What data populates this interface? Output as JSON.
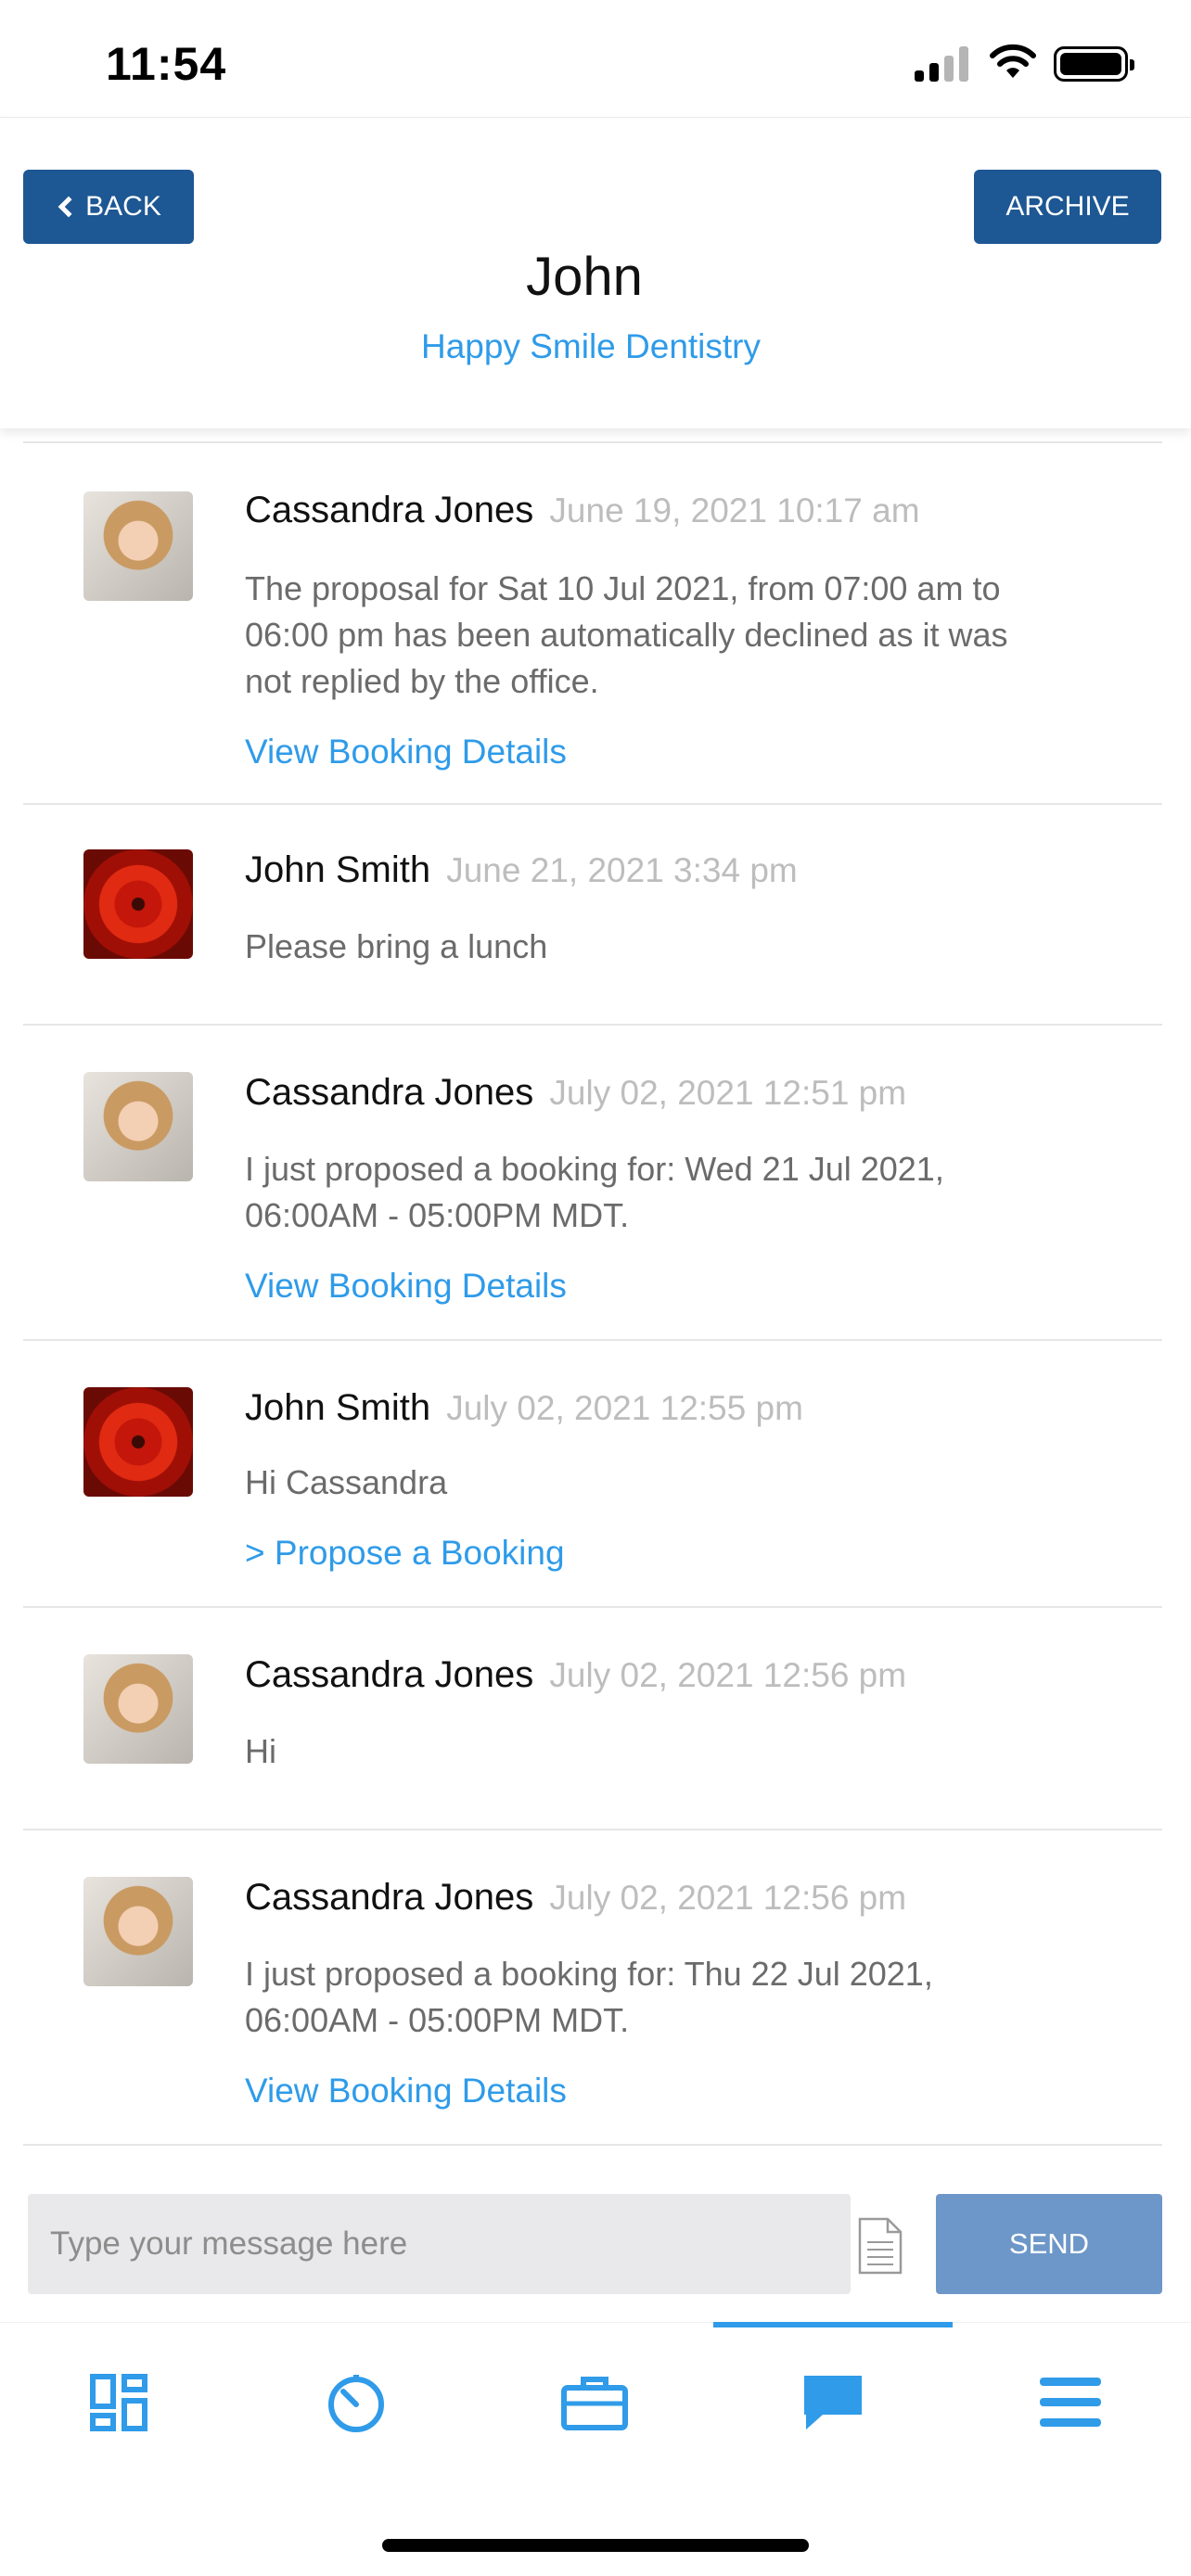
{
  "status_bar": {
    "time": "11:54"
  },
  "header": {
    "back_label": "BACK",
    "archive_label": "ARCHIVE",
    "contact_name": "John",
    "practice_name": "Happy Smile Dentistry"
  },
  "messages": [
    {
      "sender": "Cassandra Jones",
      "timestamp": "June 19, 2021 10:17 am",
      "avatar": "woman-portrait-avatar",
      "body_lines": [
        "The proposal for Sat 10 Jul 2021, from 07:00 am to",
        "06:00 pm has been automatically declined as it was",
        "not replied by the office."
      ],
      "link": "View Booking Details"
    },
    {
      "sender": "John Smith",
      "timestamp": "June 21, 2021 3:34 pm",
      "avatar": "red-flower-avatar",
      "body_lines": [
        "Please bring a lunch"
      ],
      "link": ""
    },
    {
      "sender": "Cassandra Jones",
      "timestamp": "July 02, 2021 12:51 pm",
      "avatar": "woman-portrait-avatar",
      "body_lines": [
        "I just proposed a booking for: Wed 21 Jul 2021,",
        "06:00AM - 05:00PM MDT."
      ],
      "link": "View Booking Details"
    },
    {
      "sender": "John Smith",
      "timestamp": "July 02, 2021 12:55 pm",
      "avatar": "red-flower-avatar",
      "body_lines": [
        "Hi Cassandra"
      ],
      "link": "> Propose a Booking"
    },
    {
      "sender": "Cassandra Jones",
      "timestamp": "July 02, 2021 12:56 pm",
      "avatar": "woman-portrait-avatar",
      "body_lines": [
        "Hi"
      ],
      "link": ""
    },
    {
      "sender": "Cassandra Jones",
      "timestamp": "July 02, 2021 12:56 pm",
      "avatar": "woman-portrait-avatar",
      "body_lines": [
        "I just proposed a booking for: Thu 22 Jul 2021,",
        "06:00AM - 05:00PM MDT."
      ],
      "link": "View Booking Details"
    }
  ],
  "composer": {
    "placeholder": "Type your message here",
    "send_label": "SEND",
    "attach_icon": "document-icon"
  },
  "tabbar": {
    "active_tab": "messages",
    "tabs": [
      {
        "id": "dashboard",
        "icon": "dashboard-grid-icon"
      },
      {
        "id": "timesheet",
        "icon": "stopwatch-icon"
      },
      {
        "id": "jobs",
        "icon": "briefcase-icon"
      },
      {
        "id": "messages",
        "icon": "chat-bubble-icon"
      },
      {
        "id": "menu",
        "icon": "hamburger-menu-icon"
      }
    ]
  },
  "colors": {
    "primary_button": "#1d5794",
    "link": "#2f9be9",
    "send_button": "#6c97c8",
    "timestamp": "#bdbdbd",
    "body_text": "#6b6b6b"
  }
}
